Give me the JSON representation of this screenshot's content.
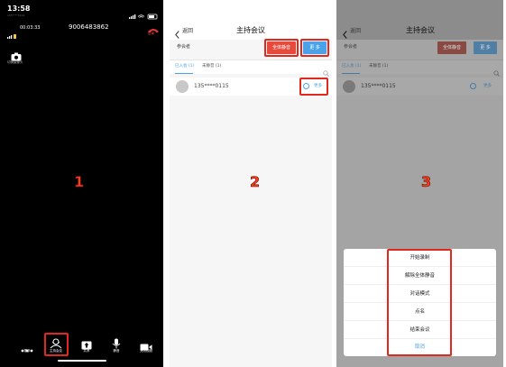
{
  "panel1": {
    "time": "13:58",
    "carrier": "135****0115",
    "call_timer": "00:03:33",
    "meeting_id": "9006483862",
    "hangup_label": "结束",
    "switch_camera_label": "切换摄像头",
    "step_number": "1",
    "toolbar": [
      "更多",
      "主持会议",
      "共享",
      "静音",
      "关闭视频"
    ]
  },
  "panel2": {
    "back_label": "返回",
    "title": "主持会议",
    "participants_label": "参会者",
    "mute_all_label": "全体静音",
    "more_label": "更 多",
    "tab_joined": "已入会 (1)",
    "tab_muted": "未静音 (1)",
    "participant_phone": "135****0115",
    "row_more_label": "更多",
    "step_number": "2"
  },
  "panel3": {
    "back_label": "返回",
    "title": "主持会议",
    "participants_label": "参会者",
    "mute_all_label": "全体静音",
    "more_label": "更 多",
    "tab_joined": "已入会 (1)",
    "tab_muted": "未静音 (1)",
    "participant_phone": "135****0115",
    "row_more_label": "更多",
    "step_number": "3",
    "sheet_items": [
      "开始录制",
      "解除全体静音",
      "对话模式",
      "点名",
      "结束会议"
    ],
    "cancel_label": "取消"
  },
  "colors": {
    "highlight": "#e0281c",
    "accent_blue": "#4aa3e8",
    "danger_red": "#e54a3d",
    "step_orange": "#ff3b1f"
  }
}
